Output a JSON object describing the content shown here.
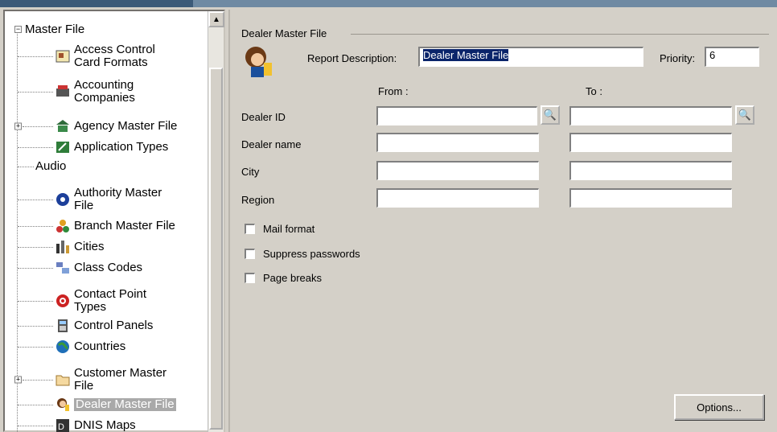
{
  "tree": {
    "root": "Master File",
    "items": [
      {
        "label": "Access Control\nCard Formats",
        "icon": "card-format-icon"
      },
      {
        "label": "Accounting\nCompanies",
        "icon": "accounting-icon"
      },
      {
        "label": "Agency Master File",
        "icon": "agency-icon"
      },
      {
        "label": "Application Types",
        "icon": "application-icon"
      },
      {
        "label": "Audio",
        "icon": ""
      },
      {
        "label": "Authority Master\nFile",
        "icon": "authority-icon"
      },
      {
        "label": "Branch Master File",
        "icon": "branch-icon"
      },
      {
        "label": "Cities",
        "icon": "cities-icon"
      },
      {
        "label": "Class Codes",
        "icon": "class-codes-icon"
      },
      {
        "label": "Contact Point\nTypes",
        "icon": "contact-point-icon"
      },
      {
        "label": "Control Panels",
        "icon": "control-panel-icon"
      },
      {
        "label": "Countries",
        "icon": "globe-icon"
      },
      {
        "label": "Customer Master\nFile",
        "icon": "folder-icon"
      },
      {
        "label": "Dealer Master File",
        "icon": "dealer-icon"
      },
      {
        "label": "DNIS Maps",
        "icon": "dnis-icon"
      }
    ]
  },
  "report": {
    "group_title": "Dealer Master File",
    "description_label": "Report Description:",
    "description_value": "Dealer Master File",
    "priority_label": "Priority:",
    "priority_value": "6",
    "from_label": "From :",
    "to_label": "To :",
    "fields": [
      "Dealer ID",
      "Dealer name",
      "City",
      "Region"
    ],
    "checkboxes": [
      "Mail format",
      "Suppress passwords",
      "Page breaks"
    ],
    "options_button": "Options..."
  }
}
